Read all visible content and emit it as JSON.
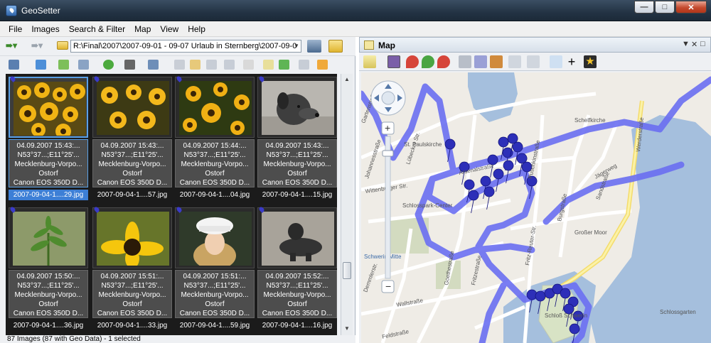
{
  "window": {
    "title": "GeoSetter"
  },
  "menu": [
    "File",
    "Images",
    "Search & Filter",
    "Map",
    "View",
    "Help"
  ],
  "address": {
    "value": "R:\\Final\\2007\\2007-09-01 - 09-07 Urlaub in Sternberg\\2007-09-0"
  },
  "images": [
    {
      "line1": "04.09.2007 15:43:...",
      "line2": "N53°37...;E11°25'...",
      "line3": "Mecklenburg-Vorpo...",
      "line4": "Ostorf",
      "line5": "Canon EOS 350D D...",
      "filename": "2007-09-04-1....29.jpg",
      "selected": true,
      "subject": "flowers"
    },
    {
      "line1": "04.09.2007 15:43:...",
      "line2": "N53°37...;E11°25'...",
      "line3": "Mecklenburg-Vorpo...",
      "line4": "Ostorf",
      "line5": "Canon EOS 350D D...",
      "filename": "2007-09-04-1....57.jpg",
      "selected": false,
      "subject": "flowers"
    },
    {
      "line1": "04.09.2007 15:44:...",
      "line2": "N53°37...;E11°25'...",
      "line3": "Mecklenburg-Vorpo...",
      "line4": "Ostorf",
      "line5": "Canon EOS 350D D...",
      "filename": "2007-09-04-1....04.jpg",
      "selected": false,
      "subject": "flowers"
    },
    {
      "line1": "04.09.2007 15:43:...",
      "line2": "N53°37...;E11°25'...",
      "line3": "Mecklenburg-Vorpo...",
      "line4": "Ostorf",
      "line5": "Canon EOS 350D D...",
      "filename": "2007-09-04-1....15.jpg",
      "selected": false,
      "subject": "dog"
    },
    {
      "line1": "04.09.2007 15:50:...",
      "line2": "N53°37...;E11°25'...",
      "line3": "Mecklenburg-Vorpo...",
      "line4": "Ostorf",
      "line5": "Canon EOS 350D D...",
      "filename": "2007-09-04-1....36.jpg",
      "selected": false,
      "subject": "plant"
    },
    {
      "line1": "04.09.2007 15:51:...",
      "line2": "N53°37...;E11°25'...",
      "line3": "Mecklenburg-Vorpo...",
      "line4": "Ostorf",
      "line5": "Canon EOS 350D D...",
      "filename": "2007-09-04-1....33.jpg",
      "selected": false,
      "subject": "sunflower"
    },
    {
      "line1": "04.09.2007 15:51:...",
      "line2": "N53°37...;E11°25'...",
      "line3": "Mecklenburg-Vorpo...",
      "line4": "Ostorf",
      "line5": "Canon EOS 350D D...",
      "filename": "2007-09-04-1....59.jpg",
      "selected": false,
      "subject": "woman"
    },
    {
      "line1": "04.09.2007 15:52:...",
      "line2": "N53°37...;E11°25'...",
      "line3": "Mecklenburg-Vorpo...",
      "line4": "Ostorf",
      "line5": "Canon EOS 350D D...",
      "filename": "2007-09-04-1....16.jpg",
      "selected": false,
      "subject": "dog-lying"
    }
  ],
  "status": "87 Images (87 with Geo Data) - 1 selected",
  "map": {
    "title": "Map",
    "streets": [
      "Arsenalstraße",
      "Schlosspark-Center",
      "Johannesstraße",
      "Wittenburger Str.",
      "Lübecker Str.",
      "Puschkinstraße",
      "Werderstraße",
      "Burgstraße",
      "Großer Moor",
      "Wallstraße",
      "Feldstraße",
      "Fritz-Reuter-Str.",
      "Schelfkirche",
      "St. Paulskirche",
      "Schwerin Mitte",
      "Schloß Schwerin",
      "Sandstraße",
      "Goethestraße",
      "Fritzestraße",
      "Jägerweg",
      "Gartenstraße",
      "Demmlerstr.",
      "Schlossgarten"
    ],
    "colors": {
      "track": "#6b6ff2",
      "pin": "#2d2fb8",
      "water": "#a5bfdd",
      "major_road": "#f8ea8a"
    }
  }
}
